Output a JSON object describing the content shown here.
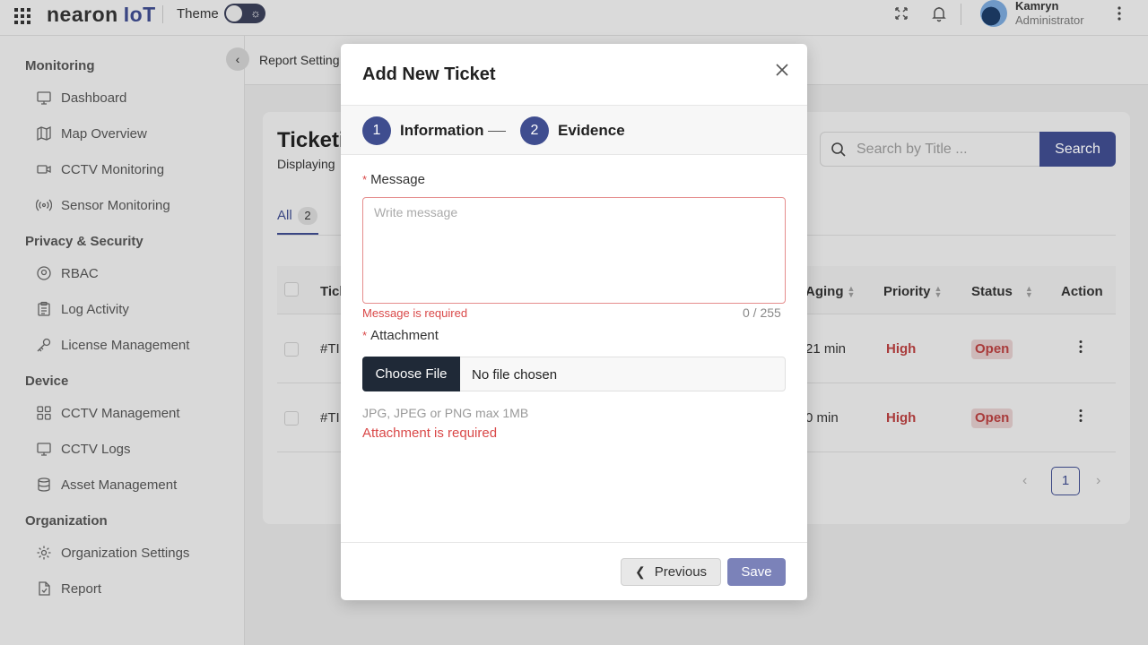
{
  "topbar": {
    "logo_main": "nearon",
    "logo_suffix": "IoT",
    "theme_label": "Theme",
    "user_name": "Kamryn",
    "user_role": "Administrator"
  },
  "sidebar": {
    "sections": [
      {
        "title": "Monitoring",
        "items": [
          "Dashboard",
          "Map Overview",
          "CCTV Monitoring",
          "Sensor Monitoring"
        ]
      },
      {
        "title": "Privacy & Security",
        "items": [
          "RBAC",
          "Log Activity",
          "License Management"
        ]
      },
      {
        "title": "Device",
        "items": [
          "CCTV Management",
          "CCTV Logs",
          "Asset Management"
        ]
      },
      {
        "title": "Organization",
        "items": [
          "Organization Settings",
          "Report"
        ]
      }
    ]
  },
  "main": {
    "breadcrumb": "Report Setting",
    "page_title": "Ticketi",
    "displaying": "Displaying",
    "tab_all_label": "All",
    "tab_all_count": "2",
    "search_placeholder": "Search by Title ...",
    "search_button": "Search",
    "table": {
      "headers": {
        "ticket": "Tick",
        "aging": "Aging",
        "priority": "Priority",
        "status": "Status",
        "action": "Action"
      },
      "rows": [
        {
          "id": "#TI",
          "aging": "21 min",
          "priority": "High",
          "status": "Open"
        },
        {
          "id": "#TI",
          "aging": "0 min",
          "priority": "High",
          "status": "Open"
        }
      ]
    },
    "pager": {
      "current": "1",
      "prev": "‹",
      "next": "›"
    }
  },
  "modal": {
    "title": "Add New Ticket",
    "steps": [
      {
        "number": "1",
        "label": "Information"
      },
      {
        "number": "2",
        "label": "Evidence"
      }
    ],
    "message_label": "Message",
    "message_placeholder": "Write message",
    "message_error": "Message is required",
    "message_counter": "0 / 255",
    "attachment_label": "Attachment",
    "choose_file": "Choose File",
    "file_status": "No file chosen",
    "attachment_hint": "JPG, JPEG or PNG max 1MB",
    "attachment_error": "Attachment is required",
    "previous_button": "Previous",
    "save_button": "Save",
    "required_mark": "*"
  },
  "colors": {
    "primary": "#3f4d8f",
    "error": "#d94848",
    "save_disabled": "#7b82b9"
  }
}
